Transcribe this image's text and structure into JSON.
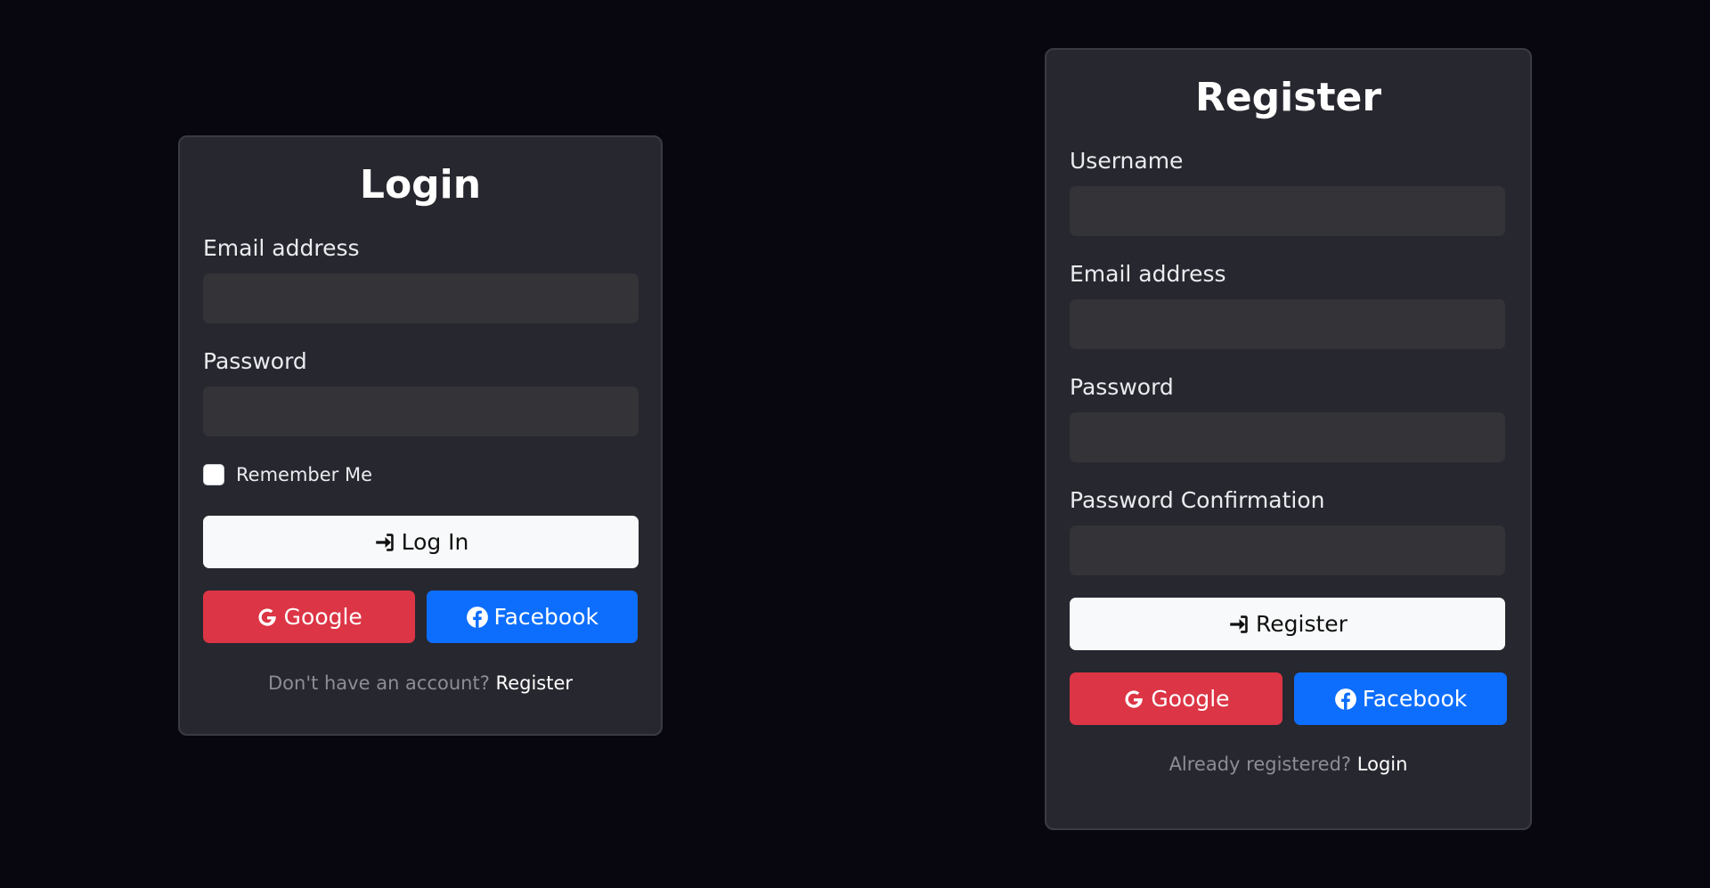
{
  "login": {
    "title": "Login",
    "email_label": "Email address",
    "email_value": "",
    "password_label": "Password",
    "password_value": "",
    "remember_label": "Remember Me",
    "remember_checked": false,
    "login_button_label": "Log In",
    "google_label": "Google",
    "facebook_label": "Facebook",
    "footer_text": "Don't have an account?",
    "footer_link": "Register"
  },
  "register": {
    "title": "Register",
    "username_label": "Username",
    "username_value": "",
    "email_label": "Email address",
    "email_value": "",
    "password_label": "Password",
    "password_value": "",
    "password_confirm_label": "Password Confirmation",
    "password_confirm_value": "",
    "register_button_label": "Register",
    "google_label": "Google",
    "facebook_label": "Facebook",
    "footer_text": "Already registered?",
    "footer_link": "Login"
  },
  "icons": {
    "login_button_icon": "sign-in-icon",
    "register_button_icon": "sign-in-icon",
    "google_icon": "google-icon",
    "facebook_icon": "facebook-icon"
  },
  "colors": {
    "background": "#08070f",
    "card": "#27272f",
    "input": "#333338",
    "google": "#dc3545",
    "facebook": "#0d6efd",
    "primary_button": "#f8f9fa"
  }
}
